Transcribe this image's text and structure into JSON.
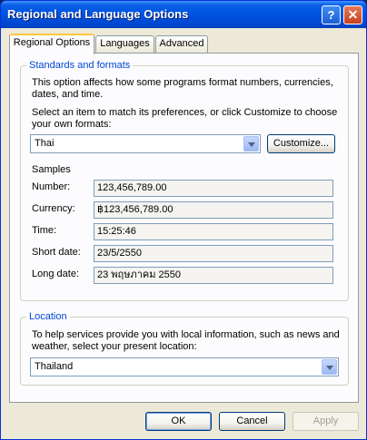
{
  "window": {
    "title": "Regional and Language Options",
    "help_glyph": "?",
    "close_glyph": "✕"
  },
  "tabs": [
    {
      "label": "Regional Options",
      "active": true
    },
    {
      "label": "Languages",
      "active": false
    },
    {
      "label": "Advanced",
      "active": false
    }
  ],
  "standards": {
    "legend": "Standards and formats",
    "desc_line1": "This option affects how some programs format numbers, currencies,",
    "desc_line2": "dates, and time.",
    "select_line1": "Select an item to match its preferences, or click Customize to choose",
    "select_line2": "your own formats:",
    "format_value": "Thai",
    "customize_label": "Customize...",
    "samples_heading": "Samples",
    "samples": [
      {
        "label": "Number:",
        "value": "123,456,789.00"
      },
      {
        "label": "Currency:",
        "value": "฿123,456,789.00"
      },
      {
        "label": "Time:",
        "value": "15:25:46"
      },
      {
        "label": "Short date:",
        "value": "23/5/2550"
      },
      {
        "label": "Long date:",
        "value": "23 พฤษภาคม 2550"
      }
    ]
  },
  "location": {
    "legend": "Location",
    "desc_line1": "To help services provide you with local information, such as news and",
    "desc_line2": "weather, select your present location:",
    "value": "Thailand"
  },
  "footer": {
    "ok_label": "OK",
    "cancel_label": "Cancel",
    "apply_label": "Apply"
  }
}
